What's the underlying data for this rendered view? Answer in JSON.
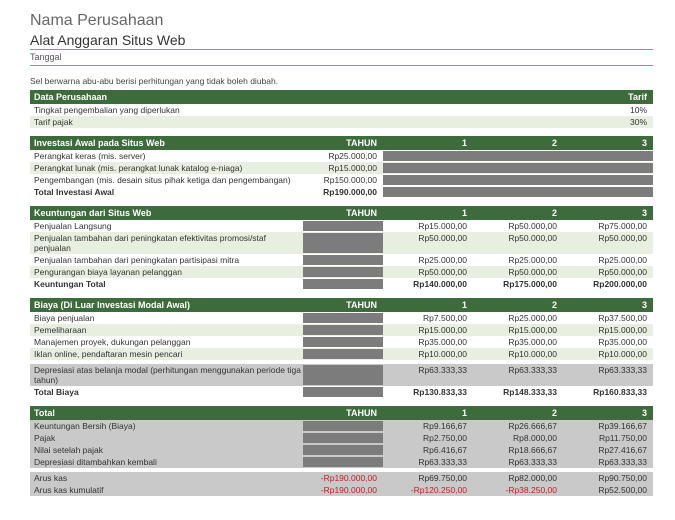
{
  "header": {
    "company_name": "Nama Perusahaan",
    "tool_title": "Alat Anggaran Situs Web",
    "date_label": "Tanggal",
    "note": "Sel berwarna abu-abu berisi perhitungan yang tidak boleh diubah."
  },
  "company_data": {
    "header_left": "Data Perusahaan",
    "header_right": "Tarif",
    "rows": [
      {
        "label": "Tingkat pengembalian yang diperlukan",
        "value": "10%"
      },
      {
        "label": "Tarif pajak",
        "value": "30%"
      }
    ]
  },
  "year_cols": {
    "tahun": "TAHUN",
    "y1": "1",
    "y2": "2",
    "y3": "3"
  },
  "investment": {
    "header": "Investasi Awal pada Situs Web",
    "rows": [
      {
        "label": "Perangkat keras (mis. server)",
        "tahun": "Rp25.000,00"
      },
      {
        "label": "Perangkat lunak (mis. perangkat lunak katalog e-niaga)",
        "tahun": "Rp15.000,00"
      },
      {
        "label": "Pengembangan (mis. desain situs pihak ketiga dan pengembangan)",
        "tahun": "Rp150.000,00"
      }
    ],
    "total": {
      "label": "Total Investasi Awal",
      "tahun": "Rp190.000,00"
    }
  },
  "benefits": {
    "header": "Keuntungan dari Situs Web",
    "rows": [
      {
        "label": "Penjualan Langsung",
        "y1": "Rp15.000,00",
        "y2": "Rp50.000,00",
        "y3": "Rp75.000,00"
      },
      {
        "label": "Penjualan tambahan dari peningkatan efektivitas promosi/staf penjualan",
        "y1": "Rp50.000,00",
        "y2": "Rp50.000,00",
        "y3": "Rp50.000,00"
      },
      {
        "label": "Penjualan tambahan dari peningkatan partisipasi mitra",
        "y1": "Rp25.000,00",
        "y2": "Rp25.000,00",
        "y3": "Rp25.000,00"
      },
      {
        "label": "Pengurangan biaya layanan pelanggan",
        "y1": "Rp50.000,00",
        "y2": "Rp50.000,00",
        "y3": "Rp50.000,00"
      }
    ],
    "total": {
      "label": "Keuntungan Total",
      "y1": "Rp140.000,00",
      "y2": "Rp175.000,00",
      "y3": "Rp200.000,00"
    }
  },
  "costs": {
    "header": "Biaya (Di Luar Investasi Modal Awal)",
    "rows": [
      {
        "label": "Biaya penjualan",
        "y1": "Rp7.500,00",
        "y2": "Rp25.000,00",
        "y3": "Rp37.500,00"
      },
      {
        "label": "Pemeliharaan",
        "y1": "Rp15.000,00",
        "y2": "Rp15.000,00",
        "y3": "Rp15.000,00"
      },
      {
        "label": "Manajemen proyek, dukungan pelanggan",
        "y1": "Rp35.000,00",
        "y2": "Rp35.000,00",
        "y3": "Rp35.000,00"
      },
      {
        "label": "Iklan online, pendaftaran mesin pencari",
        "y1": "Rp10.000,00",
        "y2": "Rp10.000,00",
        "y3": "Rp10.000,00"
      }
    ],
    "depreciation": {
      "label": "Depresiasi atas belanja modal (perhitungan menggunakan periode tiga tahun)",
      "y1": "Rp63.333,33",
      "y2": "Rp63.333,33",
      "y3": "Rp63.333,33"
    },
    "total": {
      "label": "Total Biaya",
      "y1": "Rp130.833,33",
      "y2": "Rp148.333,33",
      "y3": "Rp160.833,33"
    }
  },
  "totals": {
    "header": "Total",
    "rows": [
      {
        "label": "Keuntungan Bersih (Biaya)",
        "y1": "Rp9.166,67",
        "y2": "Rp26.666,67",
        "y3": "Rp39.166,67"
      },
      {
        "label": "Pajak",
        "y1": "Rp2.750,00",
        "y2": "Rp8.000,00",
        "y3": "Rp11.750,00"
      },
      {
        "label": "Nilai setelah pajak",
        "y1": "Rp6.416,67",
        "y2": "Rp18.666,67",
        "y3": "Rp27.416,67"
      },
      {
        "label": "Depresiasi ditambahkan kembali",
        "y1": "Rp63.333,33",
        "y2": "Rp63.333,33",
        "y3": "Rp63.333,33"
      }
    ],
    "cashflow": {
      "label": "Arus kas",
      "tahun": "-Rp190.000,00",
      "y1": "Rp69.750,00",
      "y2": "Rp82.000,00",
      "y3": "Rp90.750,00"
    },
    "cumulative": {
      "label": "Arus kas kumulatif",
      "tahun": "-Rp190.000,00",
      "y1": "-Rp120.250,00",
      "y2": "-Rp38.250,00",
      "y3": "Rp52.500,00"
    }
  }
}
